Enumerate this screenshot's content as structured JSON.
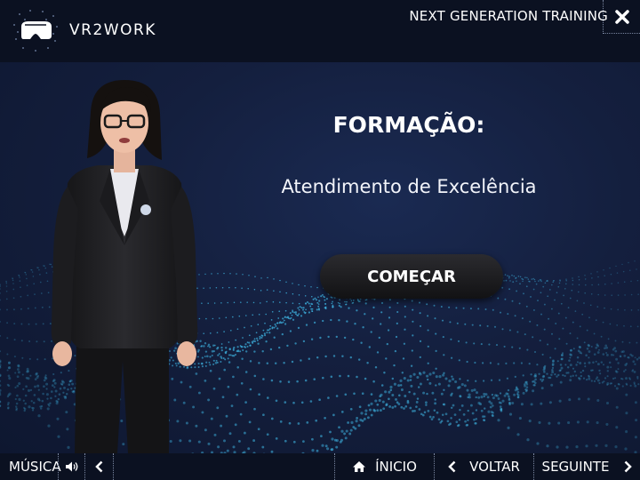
{
  "header": {
    "brand": "VR2WORK",
    "tagline": "NEXT GENERATION TRAINING",
    "close_icon": "close-x-icon"
  },
  "main": {
    "title": "FORMAÇÃO:",
    "subtitle": "Atendimento de Excelência",
    "start_label": "COMEÇAR"
  },
  "footer": {
    "music_label": "MÚSICA",
    "home_label": "ÍNICIO",
    "back_label": "VOLTAR",
    "next_label": "SEGUINTE"
  },
  "colors": {
    "background": "#141f3e",
    "bar": "#0b1121",
    "wave": "#3fb8e6",
    "button": "#1e1e22"
  }
}
